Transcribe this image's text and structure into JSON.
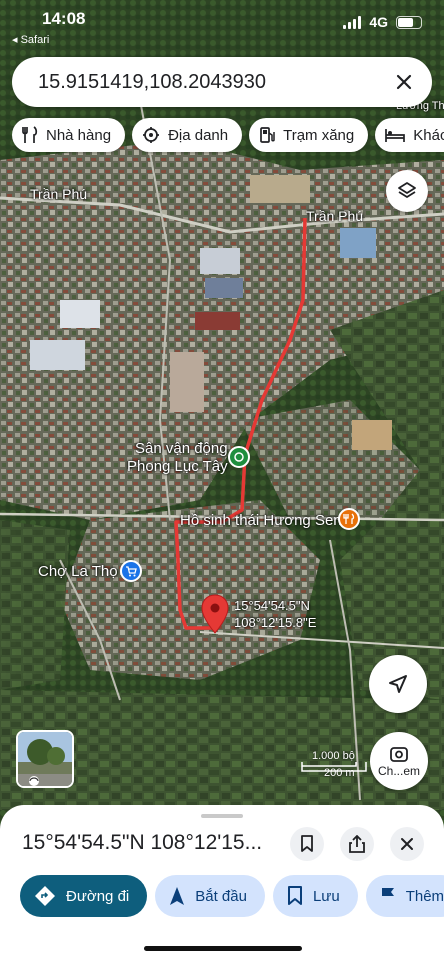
{
  "status": {
    "time": "14:08",
    "back_label": "◂ Safari",
    "network": "4G"
  },
  "search": {
    "value": "15.9151419,108.2043930"
  },
  "chips": [
    {
      "label": "Nhà hàng",
      "icon": "restaurant-icon"
    },
    {
      "label": "Địa danh",
      "icon": "landmark-icon"
    },
    {
      "label": "Trạm xăng",
      "icon": "gas-station-icon"
    },
    {
      "label": "Khách",
      "icon": "hotel-icon"
    }
  ],
  "map": {
    "labels": {
      "road1": "Trần Phú",
      "road2": "Trần Phú",
      "road3": "Lương Th",
      "stadium_1": "Sân vận động",
      "stadium_2": "Phong Lục Tây",
      "restaurant": "Hồ sinh thái Hương Sen",
      "market": "Chợ La Thọ"
    },
    "pin_coords": {
      "lat": "15°54'54.5\"N",
      "lng": "108°12'15.8\"E"
    },
    "scale": {
      "feet": "1.000 bộ",
      "meters": "200 m"
    },
    "lens_label": "Ch...em",
    "colors": {
      "route": "#e53935",
      "pin": "#e53935",
      "poi_green": "#1e8e3e",
      "poi_blue": "#1a73e8",
      "poi_orange": "#e8710a"
    }
  },
  "sheet": {
    "title": "15°54'54.5\"N 108°12'15...",
    "actions": [
      {
        "label": "Đường đi",
        "icon": "directions-icon"
      },
      {
        "label": "Bắt đầu",
        "icon": "navigation-arrow-icon"
      },
      {
        "label": "Lưu",
        "icon": "bookmark-icon"
      },
      {
        "label": "Thêm",
        "icon": "flag-icon"
      }
    ]
  }
}
